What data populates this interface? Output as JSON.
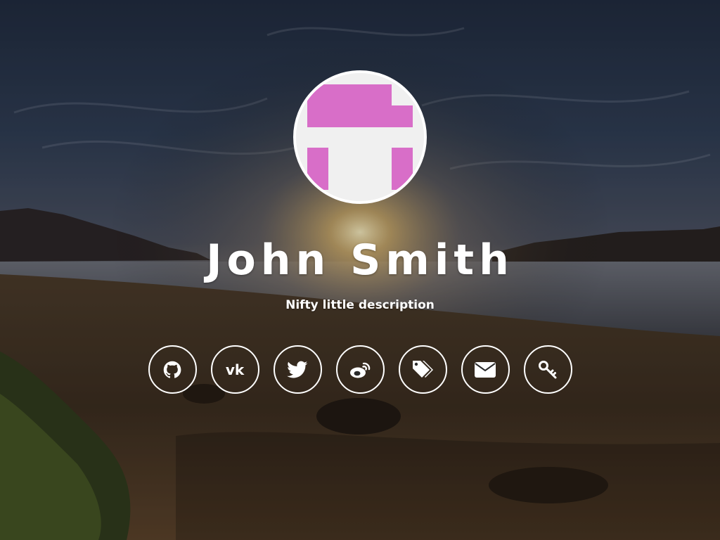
{
  "profile": {
    "name": "John Smith",
    "description": "Nifty little description",
    "avatar_colors": {
      "accent": "#d86ec8",
      "background": "#f0f0f0"
    }
  },
  "social_links": [
    {
      "id": "github",
      "icon": "github-icon"
    },
    {
      "id": "vk",
      "icon": "vk-icon",
      "glyph": "vk"
    },
    {
      "id": "twitter",
      "icon": "twitter-icon"
    },
    {
      "id": "weibo",
      "icon": "weibo-icon"
    },
    {
      "id": "tags",
      "icon": "tags-icon"
    },
    {
      "id": "email",
      "icon": "envelope-icon"
    },
    {
      "id": "key",
      "icon": "key-icon"
    }
  ],
  "colors": {
    "text": "#ffffff",
    "ring": "#ffffff"
  }
}
